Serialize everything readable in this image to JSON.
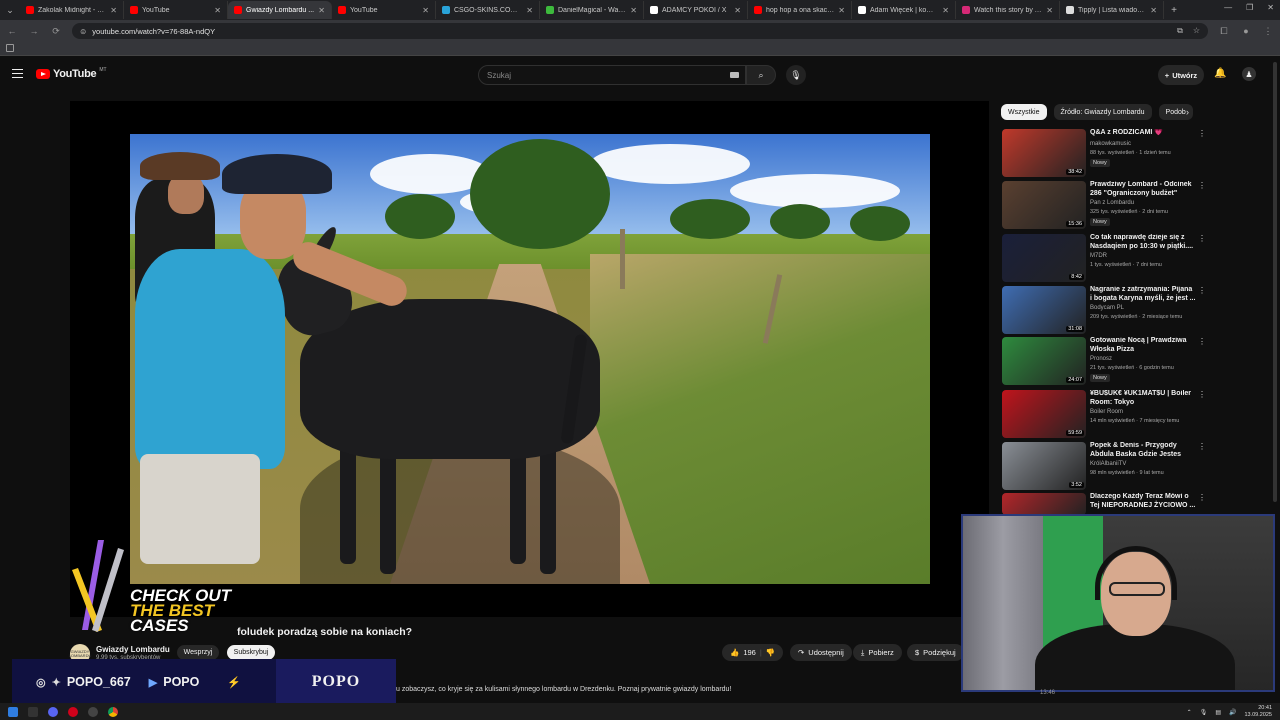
{
  "browser": {
    "tabs": [
      {
        "title": "Zakolak Midnight - Łysy ...",
        "color": "#ff0000"
      },
      {
        "title": "YouTube",
        "color": "#ff0000"
      },
      {
        "title": "Gwiazdy Lombardu ...",
        "color": "#ff0000"
      },
      {
        "title": "YouTube",
        "color": "#ff0000"
      },
      {
        "title": "CSGO-SKINS.COM - Naj...",
        "color": "#29a3d9"
      },
      {
        "title": "DanielMagical - Watch cli...",
        "color": "#3dba3d"
      },
      {
        "title": "ADAMCY POKOI / X",
        "color": "#ffffff"
      },
      {
        "title": "hop hop a ona skaczeç",
        "color": "#ff0000"
      },
      {
        "title": "Adam Więcek | kowo...",
        "color": "#ffffff"
      },
      {
        "title": "Watch this story by Adria...",
        "color": "#d62976"
      },
      {
        "title": "Tipply | Lista wiadomości",
        "color": "#dddddd"
      }
    ],
    "url": "youtube.com/watch?v=76-88A-ndQY"
  },
  "header": {
    "logo_text": "YouTube",
    "logo_country": "MT",
    "search_placeholder": "Szukaj",
    "create_label": "Utwórz"
  },
  "overlay": {
    "promo_line1": "CHECK OUT",
    "promo_line2": "THE BEST",
    "promo_line3": "CASES",
    "stream_social": "POPO_667",
    "stream_youtube": "POPO",
    "stream_brand": "POPO"
  },
  "video": {
    "title": "foludek poradzą sobie na koniach?",
    "channel": "Gwiazdy Lombardu",
    "channel_avatar_text": "GWIAZDY LOMBARDU",
    "subs": "9,99 tys. subskrybentów",
    "support_label": "Wesprzyj",
    "subscribe_label": "Subskrybuj",
    "likes": "196",
    "share_label": "Udostępnij",
    "download_label": "Pobierz",
    "thanks_label": "Podziękuj",
    "description": "u zobaczysz, co kryje się za kulisami słynnego lombardu w Drezdenku. Poznaj prywatnie gwiazdy lombardu!",
    "timestamp_hint": "13:46"
  },
  "sidebar": {
    "chips": [
      "Wszystkie",
      "Źródło: Gwiazdy Lombardu",
      "Podob"
    ],
    "recommendations": [
      {
        "title": "Q&A z RODZICAMI 💗",
        "channel": "makowkamusic",
        "meta": "88 tys. wyświetleń · 1 dzień temu",
        "badge": "Nowy",
        "duration": "38:42",
        "thumb": "#c0392b",
        "two": false
      },
      {
        "title": "Prawdziwy Lombard - Odcinek 286 \"Ograniczony budżet\"",
        "channel": "Pan z Lombardu",
        "meta": "325 tys. wyświetleń · 2 dni temu",
        "badge": "Nowy",
        "duration": "15:36",
        "thumb": "#5a4030",
        "two": true
      },
      {
        "title": "Co tak naprawdę dzieje się z Nasdaqiem po 10:30 w piątki....",
        "channel": "M7DR",
        "meta": "1 tys. wyświetleń · 7 dni temu",
        "badge": "",
        "duration": "8:42",
        "thumb": "#1a1f3a",
        "two": true
      },
      {
        "title": "Nagranie z zatrzymania: Pijana i bogata Karyna myśli, że jest ...",
        "channel": "Bodycam PL",
        "meta": "209 tys. wyświetleń · 2 miesiące temu",
        "badge": "",
        "duration": "31:08",
        "thumb": "#3f6db3",
        "two": true
      },
      {
        "title": "Gotowanie Nocą | Prawdziwa Włoska Pizza",
        "channel": "Pronosz",
        "meta": "21 tys. wyświetleń · 6 godzin temu",
        "badge": "Nowy",
        "duration": "24:07",
        "thumb": "#2e8b3e",
        "two": true
      },
      {
        "title": "¥BU$UK€ ¥UK1MAT$U | Boiler Room: Tokyo",
        "channel": "Boiler Room",
        "meta": "14 mln wyświetleń · 7 miesięcy temu",
        "badge": "",
        "duration": "59:59",
        "thumb": "#c0141c",
        "two": true
      },
      {
        "title": "Popek & Denis - Przygody Abdula Baska Gdzie Jestes",
        "channel": "KrólAlbaniiTV",
        "meta": "98 mln wyświetleń · 9 lat temu",
        "badge": "",
        "duration": "3:52",
        "thumb": "#8a8f96",
        "two": true
      },
      {
        "title": "Dlaczego Każdy Teraz Mówi o Tej NIEPORADNEJ ŻYCIOWO ...",
        "channel": "",
        "meta": "",
        "badge": "",
        "duration": "",
        "thumb": "#b3262a",
        "two": true
      }
    ]
  },
  "system": {
    "time": "20:41",
    "date": "13.09.2025"
  }
}
